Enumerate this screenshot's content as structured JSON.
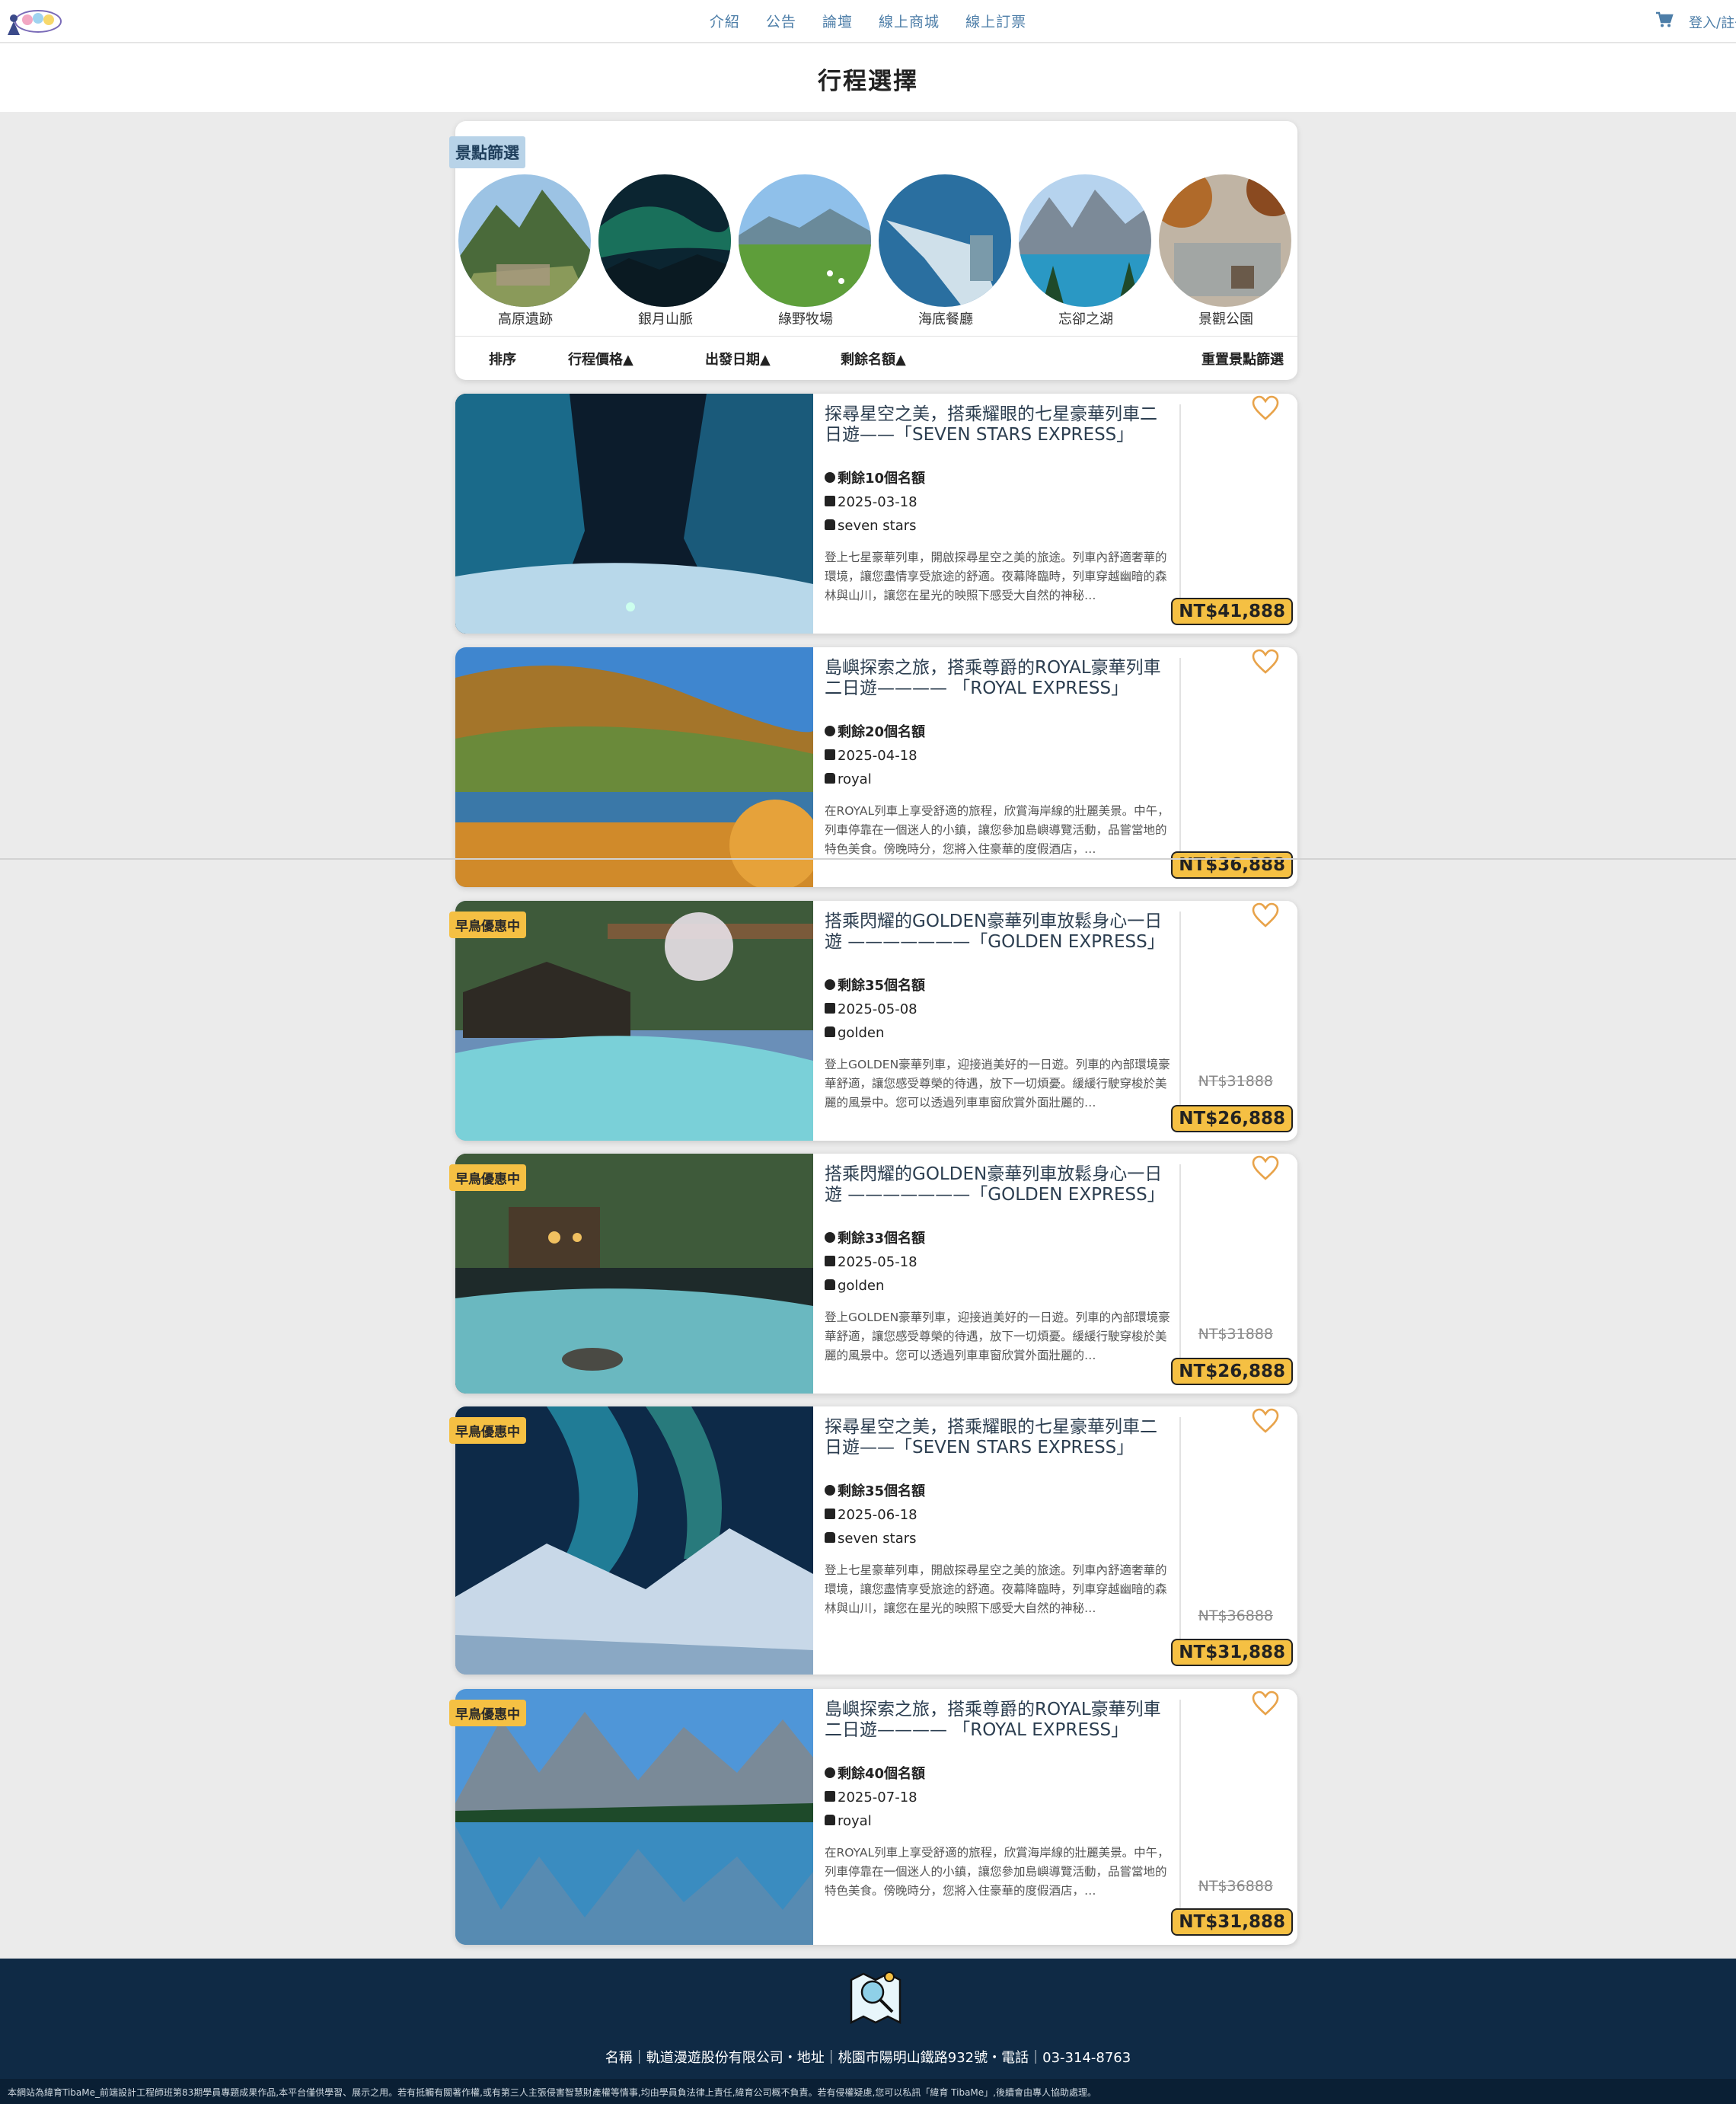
{
  "nav": {
    "links": [
      "介紹",
      "公告",
      "論壇",
      "線上商城",
      "線上訂票"
    ],
    "login": "登入/註冊"
  },
  "page": {
    "title": "行程選擇"
  },
  "filter": {
    "tag": "景點篩選",
    "spots": [
      "高原遺跡",
      "銀月山脈",
      "綠野牧場",
      "海底餐廳",
      "忘卻之湖",
      "景觀公園"
    ],
    "sort_label": "排序",
    "sort_price": "行程價格▲",
    "sort_date": "出發日期▲",
    "sort_quota": "剩餘名額▲",
    "reset": "重置景點篩選"
  },
  "trips": [
    {
      "title": "探尋星空之美，搭乘耀眼的七星豪華列車二日遊——「SEVEN STARS EXPRESS」",
      "quota": "剩餘10個名額",
      "date": "2025-03-18",
      "train": "seven stars",
      "desc": "登上七星豪華列車，開啟探尋星空之美的旅途。列車內舒適奢華的環境，讓您盡情享受旅途的舒適。夜幕降臨時，列車穿越幽暗的森林與山川，讓您在星光的映照下感受大自然的神秘…",
      "badge": "",
      "old_price": "",
      "price": "NT$41,888",
      "scene": "night"
    },
    {
      "title": "島嶼探索之旅，搭乘尊爵的ROYAL豪華列車二日遊———— 「ROYAL EXPRESS」",
      "quota": "剩餘20個名額",
      "date": "2025-04-18",
      "train": "royal",
      "desc": "在ROYAL列車上享受舒適的旅程，欣賞海岸線的壯麗美景。中午，列車停靠在一個迷人的小鎮，讓您參加島嶼導覽活動，品嘗當地的特色美食。傍晚時分，您將入住豪華的度假酒店，…",
      "badge": "",
      "old_price": "",
      "price": "NT$36,888",
      "scene": "autumn"
    },
    {
      "title": "搭乘閃耀的GOLDEN豪華列車放鬆身心一日遊 ———————「GOLDEN EXPRESS」",
      "quota": "剩餘35個名額",
      "date": "2025-05-08",
      "train": "golden",
      "desc": "登上GOLDEN豪華列車，迎接逍美好的一日遊。列車的內部環境豪華舒適，讓您感受尊榮的待遇，放下一切煩憂。緩緩行駛穿梭於美麗的風景中。您可以透過列車車窗欣賞外面壯麗的…",
      "badge": "早鳥優惠中",
      "old_price": "NT$31888",
      "price": "NT$26,888",
      "scene": "onsen"
    },
    {
      "title": "搭乘閃耀的GOLDEN豪華列車放鬆身心一日遊 ———————「GOLDEN EXPRESS」",
      "quota": "剩餘33個名額",
      "date": "2025-05-18",
      "train": "golden",
      "desc": "登上GOLDEN豪華列車，迎接逍美好的一日遊。列車的內部環境豪華舒適，讓您感受尊榮的待遇，放下一切煩憂。緩緩行駛穿梭於美麗的風景中。您可以透過列車車窗欣賞外面壯麗的…",
      "badge": "早鳥優惠中",
      "old_price": "NT$31888",
      "price": "NT$26,888",
      "scene": "onsen2"
    },
    {
      "title": "探尋星空之美，搭乘耀眼的七星豪華列車二日遊——「SEVEN STARS EXPRESS」",
      "quota": "剩餘35個名額",
      "date": "2025-06-18",
      "train": "seven stars",
      "desc": "登上七星豪華列車，開啟探尋星空之美的旅途。列車內舒適奢華的環境，讓您盡情享受旅途的舒適。夜幕降臨時，列車穿越幽暗的森林與山川，讓您在星光的映照下感受大自然的神秘…",
      "badge": "早鳥優惠中",
      "old_price": "NT$36888",
      "price": "NT$31,888",
      "scene": "aurora"
    },
    {
      "title": "島嶼探索之旅，搭乘尊爵的ROYAL豪華列車二日遊———— 「ROYAL EXPRESS」",
      "quota": "剩餘40個名額",
      "date": "2025-07-18",
      "train": "royal",
      "desc": "在ROYAL列車上享受舒適的旅程，欣賞海岸線的壯麗美景。中午，列車停靠在一個迷人的小鎮，讓您參加島嶼導覽活動，品嘗當地的特色美食。傍晚時分，您將入住豪華的度假酒店，…",
      "badge": "早鳥優惠中",
      "old_price": "NT$36888",
      "price": "NT$31,888",
      "scene": "lake"
    }
  ],
  "footer": {
    "info": "名稱｜軌道漫遊股份有限公司・地址｜桃園市陽明山鐵路932號・電話｜03-314-8763",
    "legal": "本網站為緯育TibaMe_前端設計工程師班第83期學員專題成果作品,本平台僅供學習、展示之用。若有抵觸有關著作權,或有第三人主張侵害智慧財產權等情事,均由學員負法律上責任,緯育公司概不負責。若有侵權疑慮,您可以私訊「緯育 TibaMe」,後續會由專人協助處理。"
  },
  "colors": {
    "accent": "#f5c043",
    "nav_link": "#4d7ea8",
    "footer_bg": "#0f2a45",
    "heart": "#e8a34a"
  }
}
